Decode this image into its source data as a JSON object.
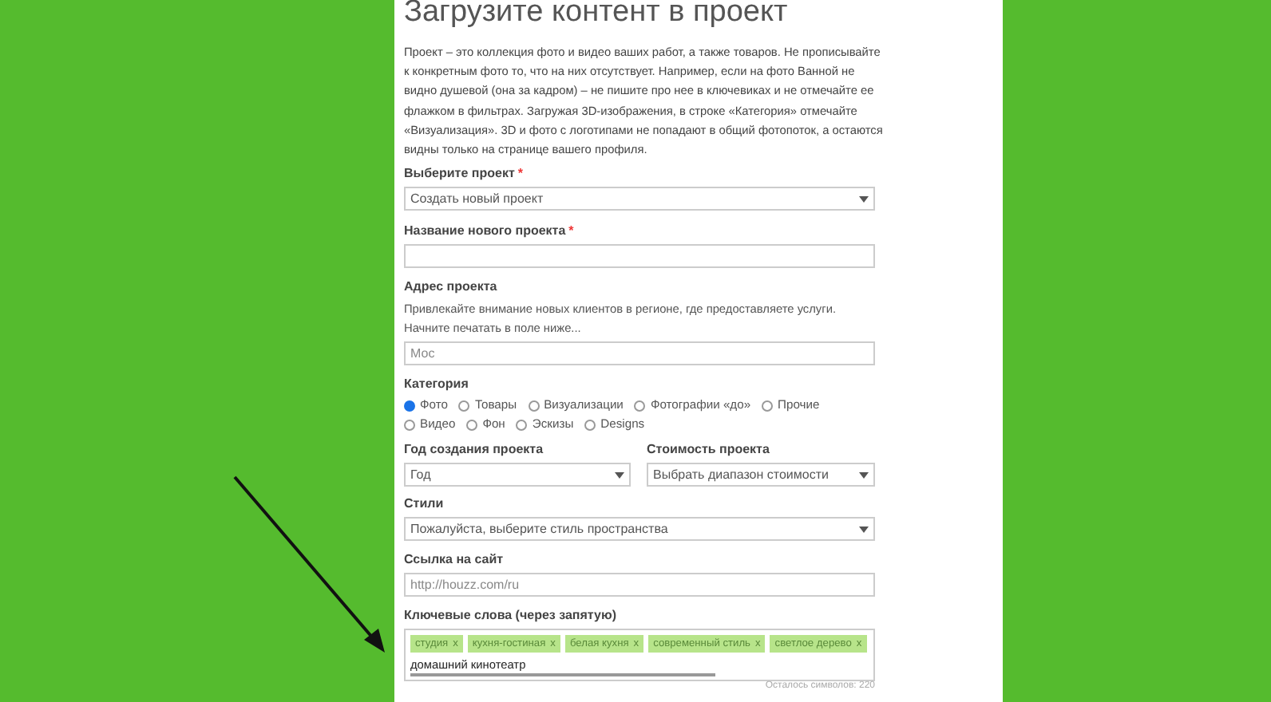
{
  "title": "Загрузите контент в проект",
  "intro": "Проект – это коллекция фото и видео ваших работ, а также товаров. Не прописывайте к конкретным фото то, что на них отсутствует. Например, если на фото Ванной не видно душевой (она за кадром) – не пишите про нее в ключевиках и не отмечайте ее флажком в фильтрах. Загружая 3D-изображения, в строке «Категория» отмечайте «Визуализация». 3D и фото с логотипами не попадают в общий фотопоток, а остаются видны только на странице вашего профиля.",
  "project_select": {
    "label": "Выберите проект",
    "required": "*",
    "value": "Создать новый проект"
  },
  "project_name": {
    "label": "Название нового проекта",
    "required": "*"
  },
  "address": {
    "label": "Адрес проекта",
    "hint": "Привлекайте внимание новых клиентов в регионе, где предоставляете услуги. Начните печатать в поле ниже...",
    "placeholder": "Мос"
  },
  "category": {
    "label": "Категория",
    "options": [
      {
        "label": "Фото",
        "selected": true
      },
      {
        "label": "Товары",
        "selected": false
      },
      {
        "label": "Визуализации",
        "selected": false
      },
      {
        "label": "Фотографии «до»",
        "selected": false
      },
      {
        "label": "Прочие",
        "selected": false
      },
      {
        "label": "Видео",
        "selected": false
      },
      {
        "label": "Фон",
        "selected": false
      },
      {
        "label": "Эскизы",
        "selected": false
      },
      {
        "label": "Designs",
        "selected": false
      }
    ]
  },
  "year": {
    "label": "Год создания проекта",
    "value": "Год"
  },
  "cost": {
    "label": "Стоимость проекта",
    "value": "Выбрать диапазон стоимости"
  },
  "styles": {
    "label": "Стили",
    "value": "Пожалуйста, выберите стиль пространства"
  },
  "website": {
    "label": "Ссылка на сайт",
    "placeholder": "http://houzz.com/ru"
  },
  "keywords": {
    "label": "Ключевые слова (через запятую)",
    "tags": [
      {
        "text": "студия",
        "remove": "x"
      },
      {
        "text": "кухня-гостиная",
        "remove": "x"
      },
      {
        "text": "белая кухня",
        "remove": "x"
      },
      {
        "text": "современный стиль",
        "remove": "x"
      },
      {
        "text": "светлое дерево",
        "remove": "x"
      }
    ],
    "value": "домашний кинотеатр",
    "counter": "Осталось символов: 220"
  }
}
